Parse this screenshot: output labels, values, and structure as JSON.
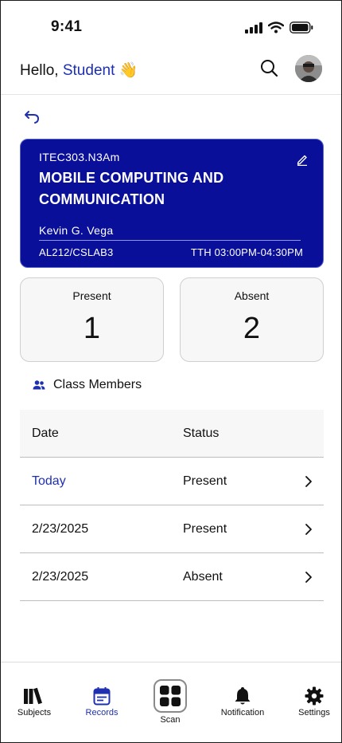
{
  "status_bar": {
    "time": "9:41"
  },
  "header": {
    "greeting": "Hello,",
    "user_name": "Student",
    "wave_emoji": "👋"
  },
  "class_card": {
    "code": "ITEC303.N3Am",
    "title": "MOBILE COMPUTING AND COMMUNICATION",
    "instructor": "Kevin G. Vega",
    "room": "AL212/CSLAB3",
    "schedule": "TTH 03:00PM-04:30PM",
    "color": "#0a0f99"
  },
  "stats": {
    "present_label": "Present",
    "present_value": "1",
    "absent_label": "Absent",
    "absent_value": "2"
  },
  "members": {
    "label": "Class Members"
  },
  "attendance_table": {
    "headers": {
      "date": "Date",
      "status": "Status"
    },
    "rows": [
      {
        "date": "Today",
        "status": "Present"
      },
      {
        "date": "2/23/2025",
        "status": "Present"
      },
      {
        "date": "2/23/2025",
        "status": "Absent"
      }
    ]
  },
  "bottom_nav": {
    "items": [
      {
        "label": "Subjects",
        "icon": "books-icon"
      },
      {
        "label": "Records",
        "icon": "calendar-icon",
        "active": true
      },
      {
        "label": "Scan",
        "icon": "scan-icon"
      },
      {
        "label": "Notification",
        "icon": "bell-icon"
      },
      {
        "label": "Settings",
        "icon": "gear-icon"
      }
    ]
  },
  "colors": {
    "accent": "#1e2fb0",
    "card": "#0a0f99"
  }
}
